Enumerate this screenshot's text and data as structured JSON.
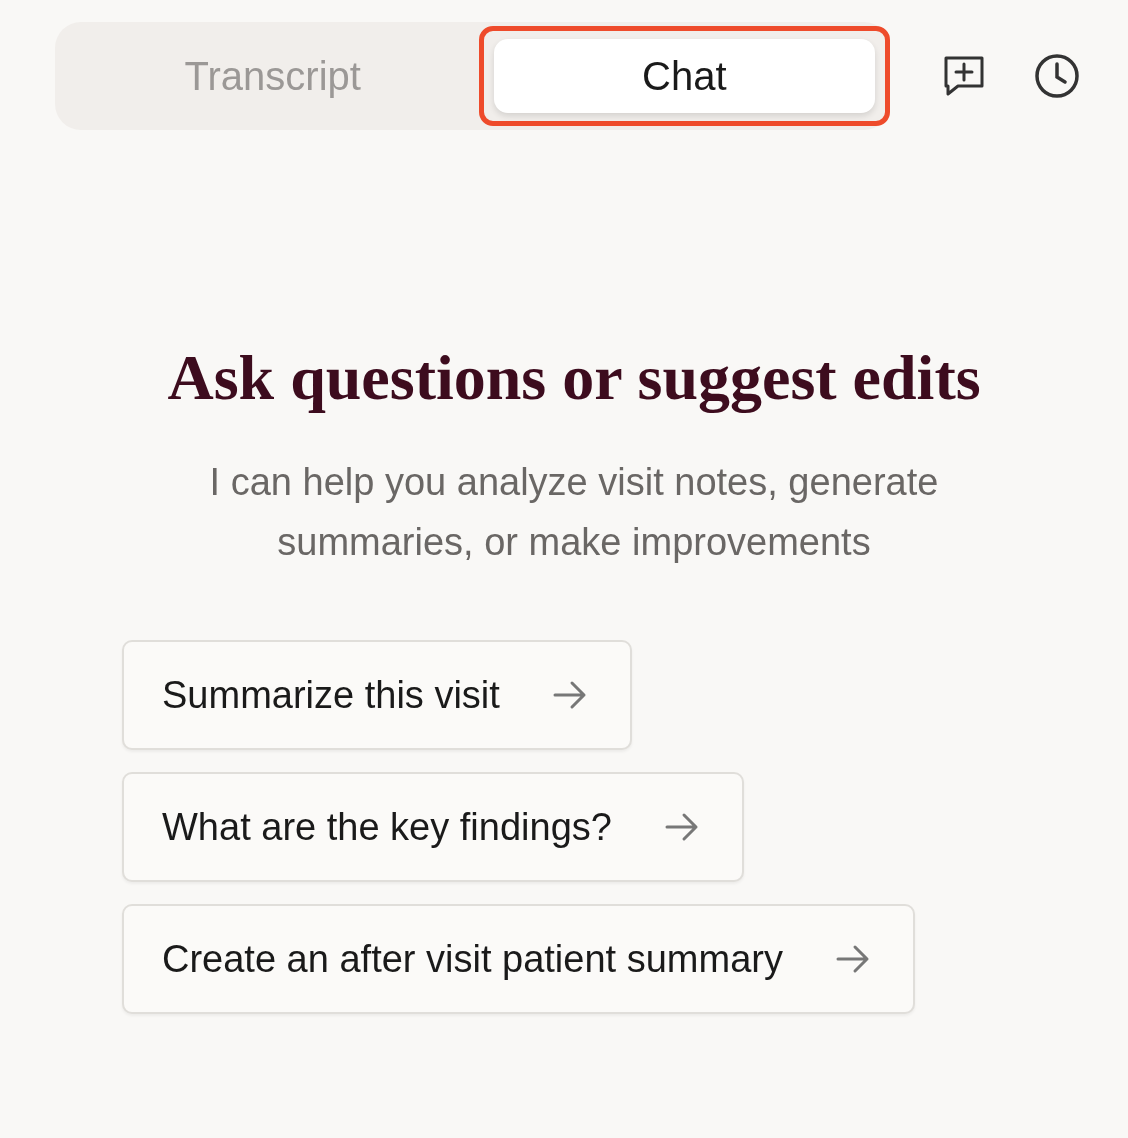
{
  "tabs": [
    {
      "label": "Transcript",
      "selected": false,
      "highlighted": false
    },
    {
      "label": "Chat",
      "selected": true,
      "highlighted": true
    }
  ],
  "heading": "Ask questions or suggest edits",
  "subtitle": "I can help you analyze visit notes, generate summaries, or make improvements",
  "suggestions": [
    "Summarize this visit",
    "What are the key findings?",
    "Create an after visit patient summary"
  ]
}
